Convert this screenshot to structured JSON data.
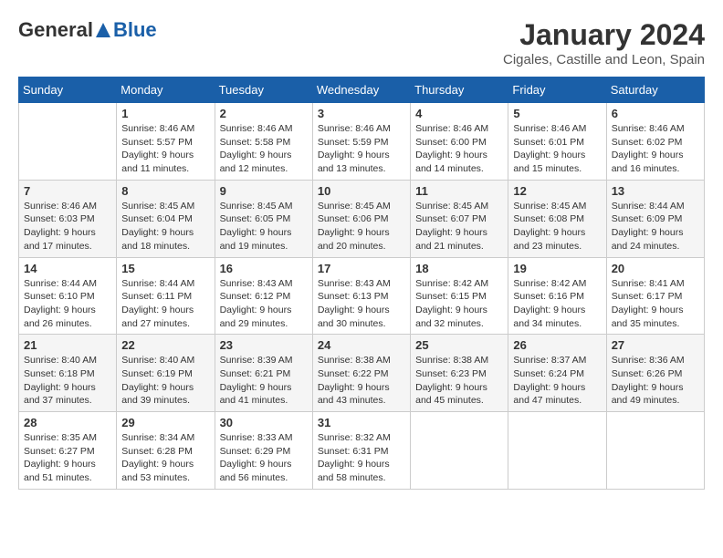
{
  "header": {
    "logo_general": "General",
    "logo_blue": "Blue",
    "month_title": "January 2024",
    "location": "Cigales, Castille and Leon, Spain"
  },
  "columns": [
    "Sunday",
    "Monday",
    "Tuesday",
    "Wednesday",
    "Thursday",
    "Friday",
    "Saturday"
  ],
  "weeks": [
    [
      {
        "day": "",
        "sunrise": "",
        "sunset": "",
        "daylight": ""
      },
      {
        "day": "1",
        "sunrise": "Sunrise: 8:46 AM",
        "sunset": "Sunset: 5:57 PM",
        "daylight": "Daylight: 9 hours and 11 minutes."
      },
      {
        "day": "2",
        "sunrise": "Sunrise: 8:46 AM",
        "sunset": "Sunset: 5:58 PM",
        "daylight": "Daylight: 9 hours and 12 minutes."
      },
      {
        "day": "3",
        "sunrise": "Sunrise: 8:46 AM",
        "sunset": "Sunset: 5:59 PM",
        "daylight": "Daylight: 9 hours and 13 minutes."
      },
      {
        "day": "4",
        "sunrise": "Sunrise: 8:46 AM",
        "sunset": "Sunset: 6:00 PM",
        "daylight": "Daylight: 9 hours and 14 minutes."
      },
      {
        "day": "5",
        "sunrise": "Sunrise: 8:46 AM",
        "sunset": "Sunset: 6:01 PM",
        "daylight": "Daylight: 9 hours and 15 minutes."
      },
      {
        "day": "6",
        "sunrise": "Sunrise: 8:46 AM",
        "sunset": "Sunset: 6:02 PM",
        "daylight": "Daylight: 9 hours and 16 minutes."
      }
    ],
    [
      {
        "day": "7",
        "sunrise": "Sunrise: 8:46 AM",
        "sunset": "Sunset: 6:03 PM",
        "daylight": "Daylight: 9 hours and 17 minutes."
      },
      {
        "day": "8",
        "sunrise": "Sunrise: 8:45 AM",
        "sunset": "Sunset: 6:04 PM",
        "daylight": "Daylight: 9 hours and 18 minutes."
      },
      {
        "day": "9",
        "sunrise": "Sunrise: 8:45 AM",
        "sunset": "Sunset: 6:05 PM",
        "daylight": "Daylight: 9 hours and 19 minutes."
      },
      {
        "day": "10",
        "sunrise": "Sunrise: 8:45 AM",
        "sunset": "Sunset: 6:06 PM",
        "daylight": "Daylight: 9 hours and 20 minutes."
      },
      {
        "day": "11",
        "sunrise": "Sunrise: 8:45 AM",
        "sunset": "Sunset: 6:07 PM",
        "daylight": "Daylight: 9 hours and 21 minutes."
      },
      {
        "day": "12",
        "sunrise": "Sunrise: 8:45 AM",
        "sunset": "Sunset: 6:08 PM",
        "daylight": "Daylight: 9 hours and 23 minutes."
      },
      {
        "day": "13",
        "sunrise": "Sunrise: 8:44 AM",
        "sunset": "Sunset: 6:09 PM",
        "daylight": "Daylight: 9 hours and 24 minutes."
      }
    ],
    [
      {
        "day": "14",
        "sunrise": "Sunrise: 8:44 AM",
        "sunset": "Sunset: 6:10 PM",
        "daylight": "Daylight: 9 hours and 26 minutes."
      },
      {
        "day": "15",
        "sunrise": "Sunrise: 8:44 AM",
        "sunset": "Sunset: 6:11 PM",
        "daylight": "Daylight: 9 hours and 27 minutes."
      },
      {
        "day": "16",
        "sunrise": "Sunrise: 8:43 AM",
        "sunset": "Sunset: 6:12 PM",
        "daylight": "Daylight: 9 hours and 29 minutes."
      },
      {
        "day": "17",
        "sunrise": "Sunrise: 8:43 AM",
        "sunset": "Sunset: 6:13 PM",
        "daylight": "Daylight: 9 hours and 30 minutes."
      },
      {
        "day": "18",
        "sunrise": "Sunrise: 8:42 AM",
        "sunset": "Sunset: 6:15 PM",
        "daylight": "Daylight: 9 hours and 32 minutes."
      },
      {
        "day": "19",
        "sunrise": "Sunrise: 8:42 AM",
        "sunset": "Sunset: 6:16 PM",
        "daylight": "Daylight: 9 hours and 34 minutes."
      },
      {
        "day": "20",
        "sunrise": "Sunrise: 8:41 AM",
        "sunset": "Sunset: 6:17 PM",
        "daylight": "Daylight: 9 hours and 35 minutes."
      }
    ],
    [
      {
        "day": "21",
        "sunrise": "Sunrise: 8:40 AM",
        "sunset": "Sunset: 6:18 PM",
        "daylight": "Daylight: 9 hours and 37 minutes."
      },
      {
        "day": "22",
        "sunrise": "Sunrise: 8:40 AM",
        "sunset": "Sunset: 6:19 PM",
        "daylight": "Daylight: 9 hours and 39 minutes."
      },
      {
        "day": "23",
        "sunrise": "Sunrise: 8:39 AM",
        "sunset": "Sunset: 6:21 PM",
        "daylight": "Daylight: 9 hours and 41 minutes."
      },
      {
        "day": "24",
        "sunrise": "Sunrise: 8:38 AM",
        "sunset": "Sunset: 6:22 PM",
        "daylight": "Daylight: 9 hours and 43 minutes."
      },
      {
        "day": "25",
        "sunrise": "Sunrise: 8:38 AM",
        "sunset": "Sunset: 6:23 PM",
        "daylight": "Daylight: 9 hours and 45 minutes."
      },
      {
        "day": "26",
        "sunrise": "Sunrise: 8:37 AM",
        "sunset": "Sunset: 6:24 PM",
        "daylight": "Daylight: 9 hours and 47 minutes."
      },
      {
        "day": "27",
        "sunrise": "Sunrise: 8:36 AM",
        "sunset": "Sunset: 6:26 PM",
        "daylight": "Daylight: 9 hours and 49 minutes."
      }
    ],
    [
      {
        "day": "28",
        "sunrise": "Sunrise: 8:35 AM",
        "sunset": "Sunset: 6:27 PM",
        "daylight": "Daylight: 9 hours and 51 minutes."
      },
      {
        "day": "29",
        "sunrise": "Sunrise: 8:34 AM",
        "sunset": "Sunset: 6:28 PM",
        "daylight": "Daylight: 9 hours and 53 minutes."
      },
      {
        "day": "30",
        "sunrise": "Sunrise: 8:33 AM",
        "sunset": "Sunset: 6:29 PM",
        "daylight": "Daylight: 9 hours and 56 minutes."
      },
      {
        "day": "31",
        "sunrise": "Sunrise: 8:32 AM",
        "sunset": "Sunset: 6:31 PM",
        "daylight": "Daylight: 9 hours and 58 minutes."
      },
      {
        "day": "",
        "sunrise": "",
        "sunset": "",
        "daylight": ""
      },
      {
        "day": "",
        "sunrise": "",
        "sunset": "",
        "daylight": ""
      },
      {
        "day": "",
        "sunrise": "",
        "sunset": "",
        "daylight": ""
      }
    ]
  ]
}
